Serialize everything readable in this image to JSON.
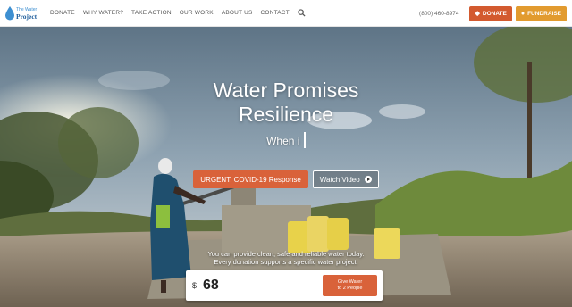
{
  "logo": {
    "line1": "The Water",
    "line2": "Project"
  },
  "nav": {
    "items": [
      "DONATE",
      "WHY WATER?",
      "TAKE ACTION",
      "OUR WORK",
      "ABOUT US",
      "CONTACT"
    ],
    "phone": "(800) 460-8974",
    "donate_label": "DONATE",
    "fundraise_label": "FUNDRAISE"
  },
  "hero": {
    "headline_line1": "Water Promises",
    "headline_line2": "Resilience",
    "typing_text": "When i",
    "urgent_button": "URGENT: COVID-19 Response",
    "video_button": "Watch Video",
    "tagline_line1": "You can provide clean, safe and reliable water today.",
    "tagline_line2": "Every donation supports a specific water project."
  },
  "donate_form": {
    "currency": "$",
    "amount": "68",
    "give_line1": "Give Water",
    "give_line2": "to 2 People"
  },
  "colors": {
    "accent_orange": "#d9623a",
    "fundraise_gold": "#e29b2f",
    "brand_blue": "#1f5e9c"
  }
}
